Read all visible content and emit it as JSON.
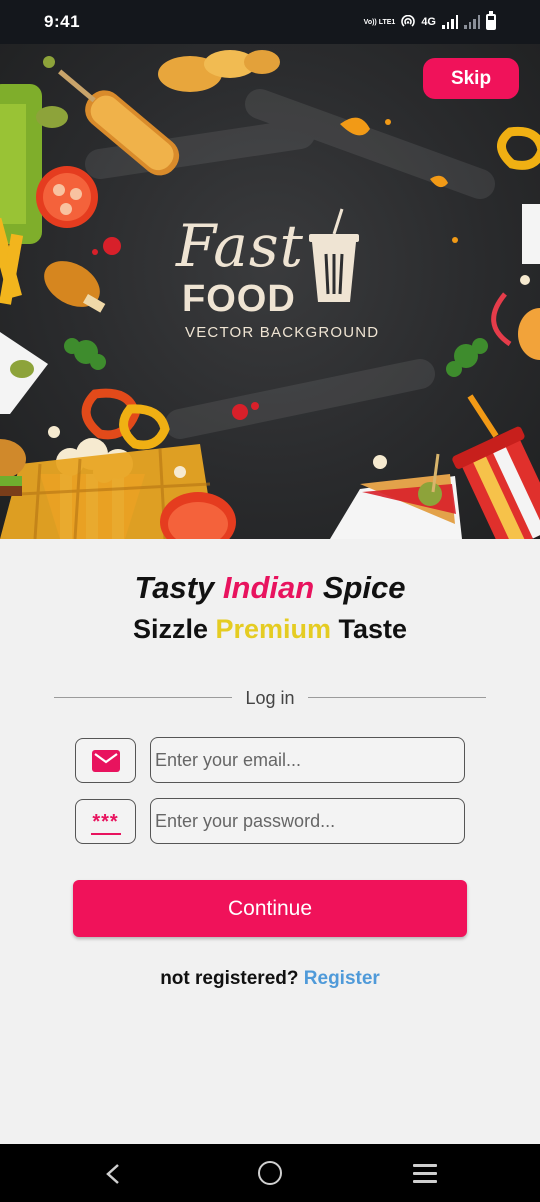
{
  "status_bar": {
    "time": "9:41",
    "lte_label": "Vo)) LTE1",
    "network_label": "4G",
    "icons": [
      "hotspot-icon",
      "signal-icon",
      "signal-icon",
      "battery-icon"
    ]
  },
  "hero": {
    "skip_label": "Skip",
    "logo_line1": "Fast",
    "logo_line2": "FOOD",
    "logo_line3": "VECTOR BACKGROUND",
    "background_color": "#2d2e30"
  },
  "headline": {
    "line1_part1": "Tasty ",
    "line1_accent": "Indian",
    "line1_part2": " Spice",
    "line2_part1": "Sizzle ",
    "line2_accent": "Premium",
    "line2_part2": " Taste"
  },
  "login": {
    "divider_label": "Log in",
    "email_placeholder": "Enter your email...",
    "email_value": "",
    "password_placeholder": "Enter your password...",
    "password_value": "",
    "password_icon_text": "***",
    "continue_label": "Continue",
    "register_prompt": "not registered?",
    "register_link": "Register"
  },
  "nav_bar": {
    "icons": [
      "back-icon",
      "home-icon",
      "recent-apps-icon"
    ]
  },
  "colors": {
    "accent_pink": "#f0125a",
    "accent_yellow": "#e5cc22",
    "link_blue": "#4f9ad9",
    "background": "#f1f1f1"
  }
}
